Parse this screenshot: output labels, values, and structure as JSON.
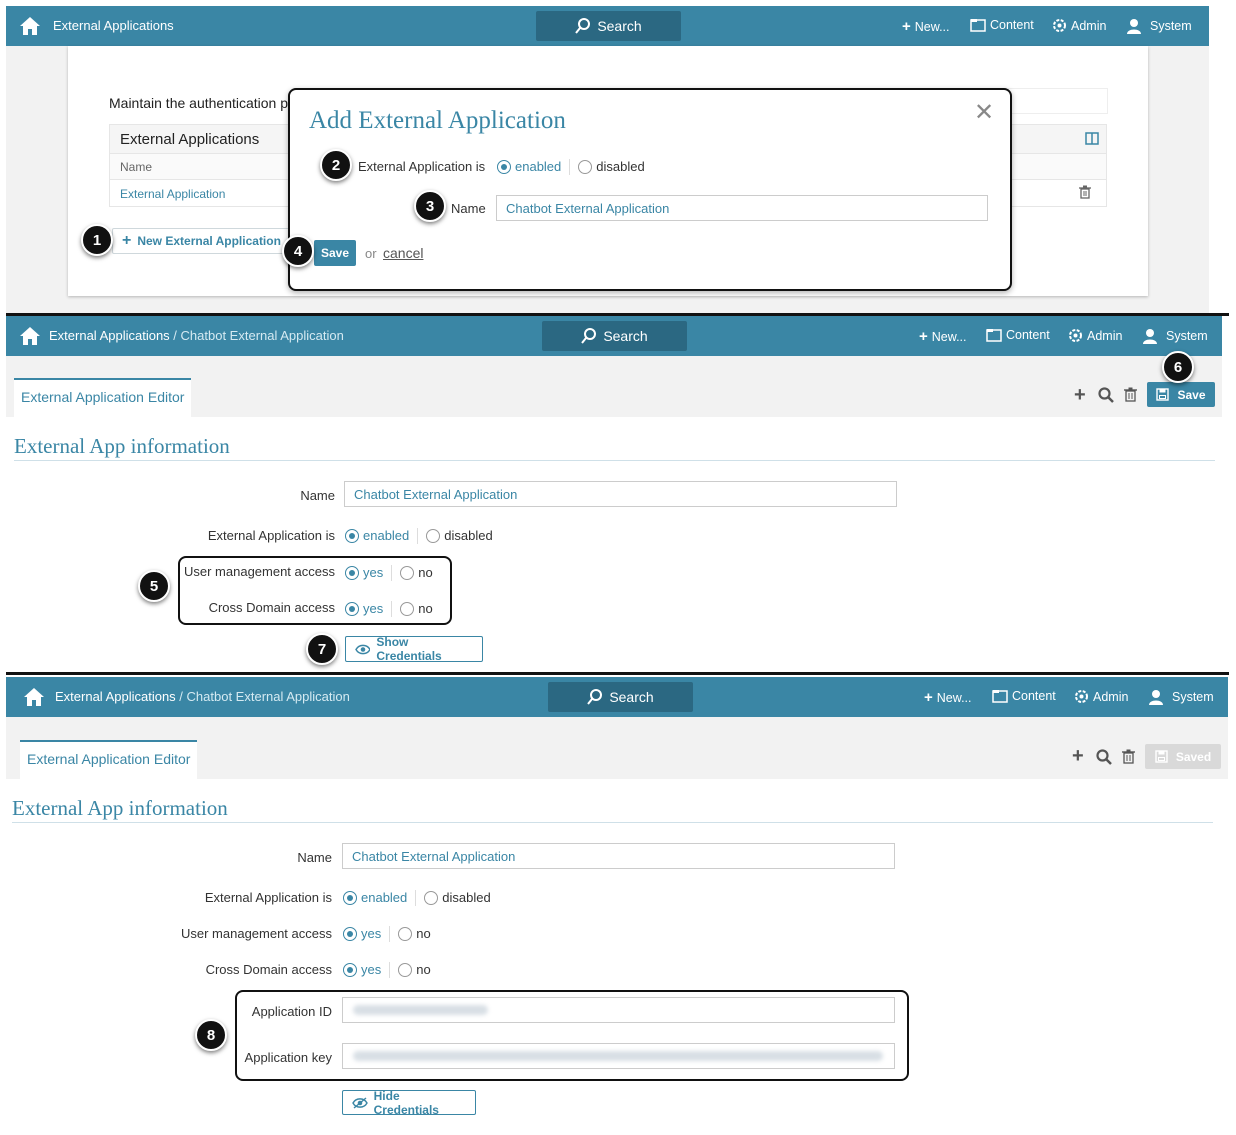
{
  "nav": {
    "app_title": "External Applications",
    "breadcrumb_root": "External Applications",
    "breadcrumb_sep": " / ",
    "breadcrumb_current": "Chatbot External Application",
    "search": "Search",
    "new": "New...",
    "content": "Content",
    "admin": "Admin",
    "system": "System"
  },
  "section1": {
    "intro": "Maintain the authentication p",
    "table_title": "External Applications",
    "col_name": "Name",
    "row_name": "External Application",
    "new_button": "New External Application",
    "dialog": {
      "title": "Add External Application",
      "status_label": "External Application is",
      "enabled": "enabled",
      "disabled": "disabled",
      "name_label": "Name",
      "name_value": "Chatbot External Application",
      "save": "Save",
      "or": "or",
      "cancel": "cancel"
    }
  },
  "editor": {
    "tab": "External Application Editor",
    "heading": "External App information",
    "name_label": "Name",
    "name_value": "Chatbot External Application",
    "status_label": "External Application is",
    "enabled": "enabled",
    "disabled": "disabled",
    "user_mgmt_label": "User management access",
    "cross_domain_label": "Cross Domain access",
    "yes": "yes",
    "no": "no",
    "save": "Save",
    "saved": "Saved",
    "show_credentials": "Show Credentials",
    "hide_credentials": "Hide Credentials",
    "app_id_label": "Application ID",
    "app_key_label": "Application key"
  },
  "badges": [
    "1",
    "2",
    "3",
    "4",
    "5",
    "6",
    "7",
    "8"
  ],
  "colors": {
    "accent": "#3a86a5",
    "accent_dark": "#2b6882"
  }
}
